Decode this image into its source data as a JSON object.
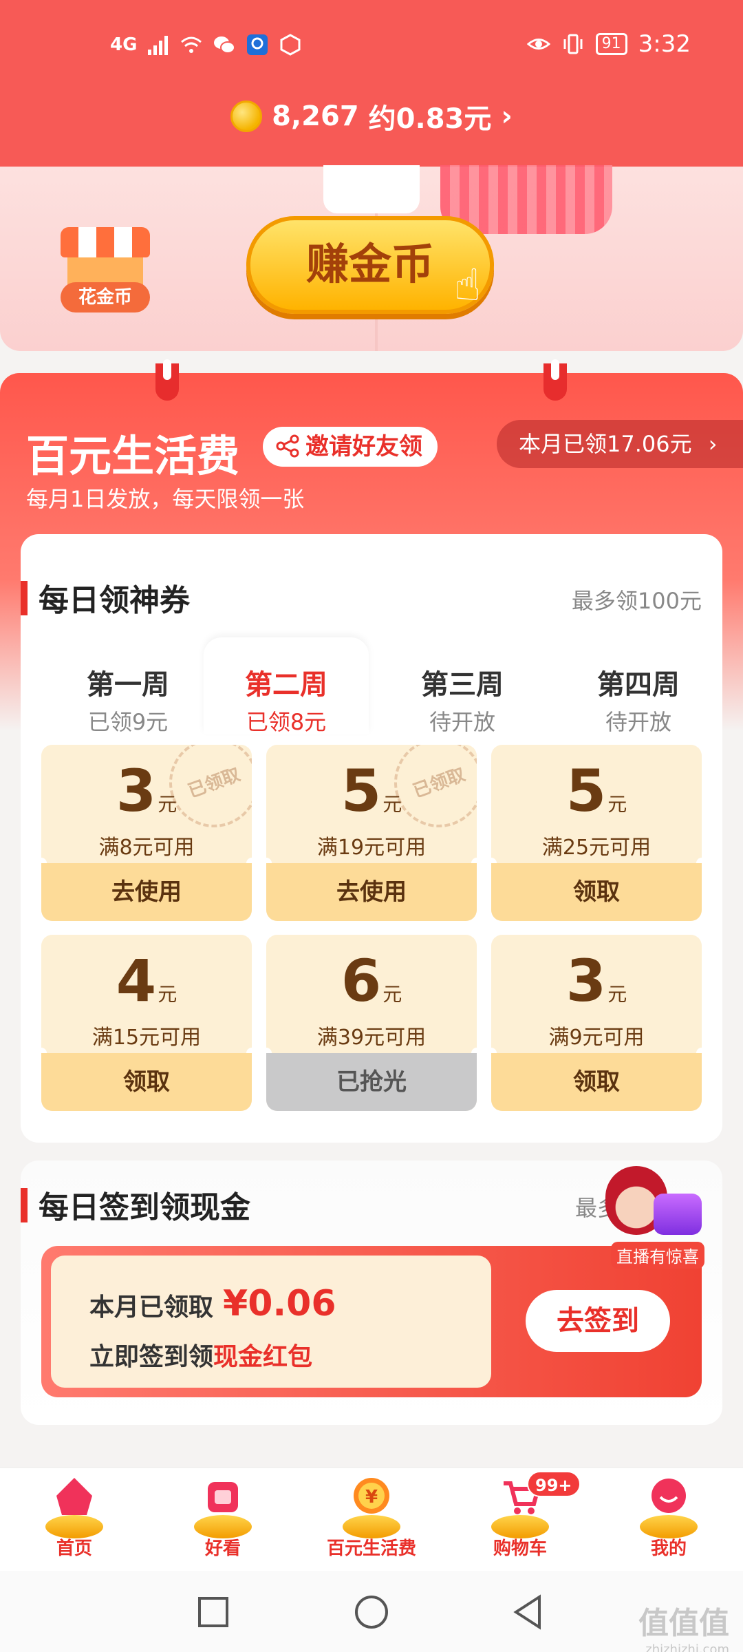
{
  "status_bar": {
    "network": "4G",
    "time": "3:32",
    "battery": "91"
  },
  "coins": {
    "count": "8,267",
    "approx": "约0.83元",
    "chevron": "›"
  },
  "banner": {
    "shop_label": "花金币",
    "earn_button": "赚金币"
  },
  "panel": {
    "title": "百元生活费",
    "invite_label": "邀请好友领",
    "month_received": "本月已领17.06元",
    "month_chevron": "›",
    "subtitle": "每月1日发放，每天限领一张"
  },
  "daily_coupon": {
    "title": "每日领神券",
    "max_note": "最多领100元",
    "weeks": [
      {
        "label": "第一周",
        "status": "已领9元",
        "active": false
      },
      {
        "label": "第二周",
        "status": "已领8元",
        "active": true
      },
      {
        "label": "第三周",
        "status": "待开放",
        "active": false
      },
      {
        "label": "第四周",
        "status": "待开放",
        "active": false
      }
    ],
    "unit": "元",
    "claimed_stamp": "已领取",
    "coupons": [
      {
        "amount": "3",
        "condition": "满8元可用",
        "button": "去使用",
        "claimed": true
      },
      {
        "amount": "5",
        "condition": "满19元可用",
        "button": "去使用",
        "claimed": true
      },
      {
        "amount": "5",
        "condition": "满25元可用",
        "button": "领取",
        "claimed": false
      },
      {
        "amount": "4",
        "condition": "满15元可用",
        "button": "领取",
        "claimed": false
      },
      {
        "amount": "6",
        "condition": "满39元可用",
        "button": "已抢光",
        "claimed": false
      },
      {
        "amount": "3",
        "condition": "满9元可用",
        "button": "领取",
        "claimed": false
      }
    ]
  },
  "daily_signin": {
    "title": "每日签到领现金",
    "right_note": "最多",
    "live_caption": "直播有惊喜",
    "received_label": "本月已领取",
    "received_amount": "¥0.06",
    "cta_prefix": "立即签到领",
    "cta_highlight": "现金红包",
    "button": "去签到"
  },
  "bottom_nav": {
    "tabs": [
      {
        "label": "首页",
        "icon": "home-icon"
      },
      {
        "label": "好看",
        "icon": "video-icon"
      },
      {
        "label": "百元生活费",
        "icon": "yuan-coin-icon"
      },
      {
        "label": "购物车",
        "icon": "cart-icon",
        "badge": "99+"
      },
      {
        "label": "我的",
        "icon": "profile-icon"
      }
    ]
  },
  "watermark": {
    "text": "值值值",
    "url": "zhizhizhi.com"
  },
  "colors": {
    "accent": "#e9302a",
    "header": "#f75a56",
    "coupon_bg": "#fdf0d5",
    "coupon_button": "#fddb98"
  }
}
